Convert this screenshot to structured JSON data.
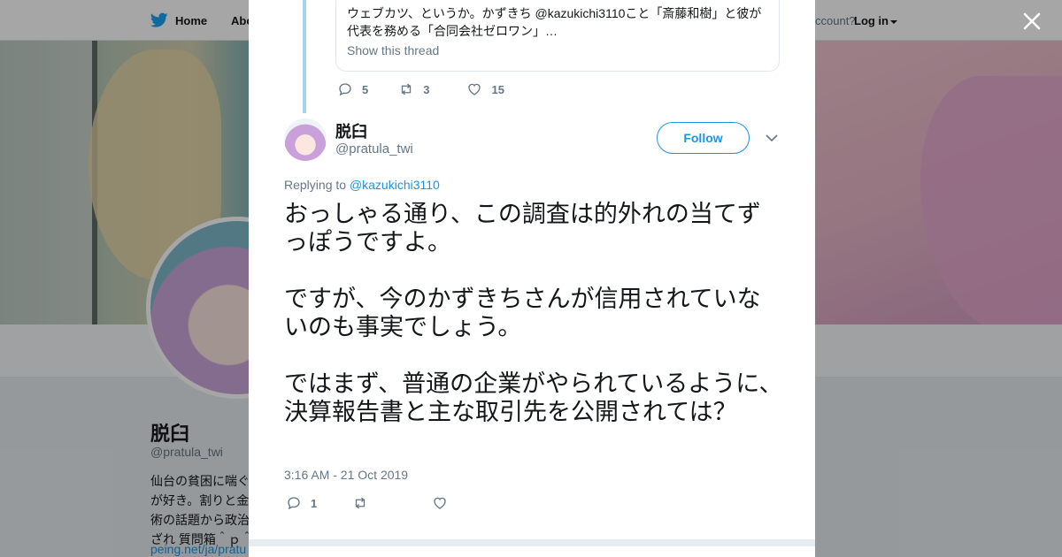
{
  "topnav": {
    "home_label": "Home",
    "about_label": "Abo",
    "account_text": "ccount?",
    "login_label": "Log in"
  },
  "profile": {
    "name": "脱臼",
    "handle": "@pratula_twi",
    "bio": "仙台の貧困に喘ぐ\nが好き。割りと金\n術の話題から政治\nざれ 質問箱＾ｐ＾",
    "link": "peing.net/ja/pratu"
  },
  "modal": {
    "quote": {
      "text": "ウェブカツ、というか。かずきち @kazukichi3110こと「斎藤和樹」と彼が代表を務める「合同会社ゼロワン」…",
      "show_thread": "Show this thread"
    },
    "parent_actions": {
      "replies": "5",
      "retweets": "3",
      "likes": "15"
    },
    "author": {
      "name": "脱臼",
      "handle": "@pratula_twi",
      "follow_label": "Follow"
    },
    "replying_prefix": "Replying to",
    "replying_to": "@kazukichi3110",
    "tweet_paragraphs": [
      "おっしゃる通り、この調査は的外れの当てずっぽうですよ。",
      "ですが、今のかずきちさんが信用されていないのも事実でしょう。",
      "ではまず、普通の企業がやられているように、決算報告書と主な取引先を公開されては？"
    ],
    "timestamp": "3:16 AM - 21 Oct 2019",
    "actions": {
      "replies": "1",
      "retweets": "",
      "likes": ""
    }
  },
  "colors": {
    "twitter_blue": "#1b95e0",
    "secondary_text": "#657786",
    "primary_text": "#14171a",
    "thread_line": "#a8d3ee"
  }
}
